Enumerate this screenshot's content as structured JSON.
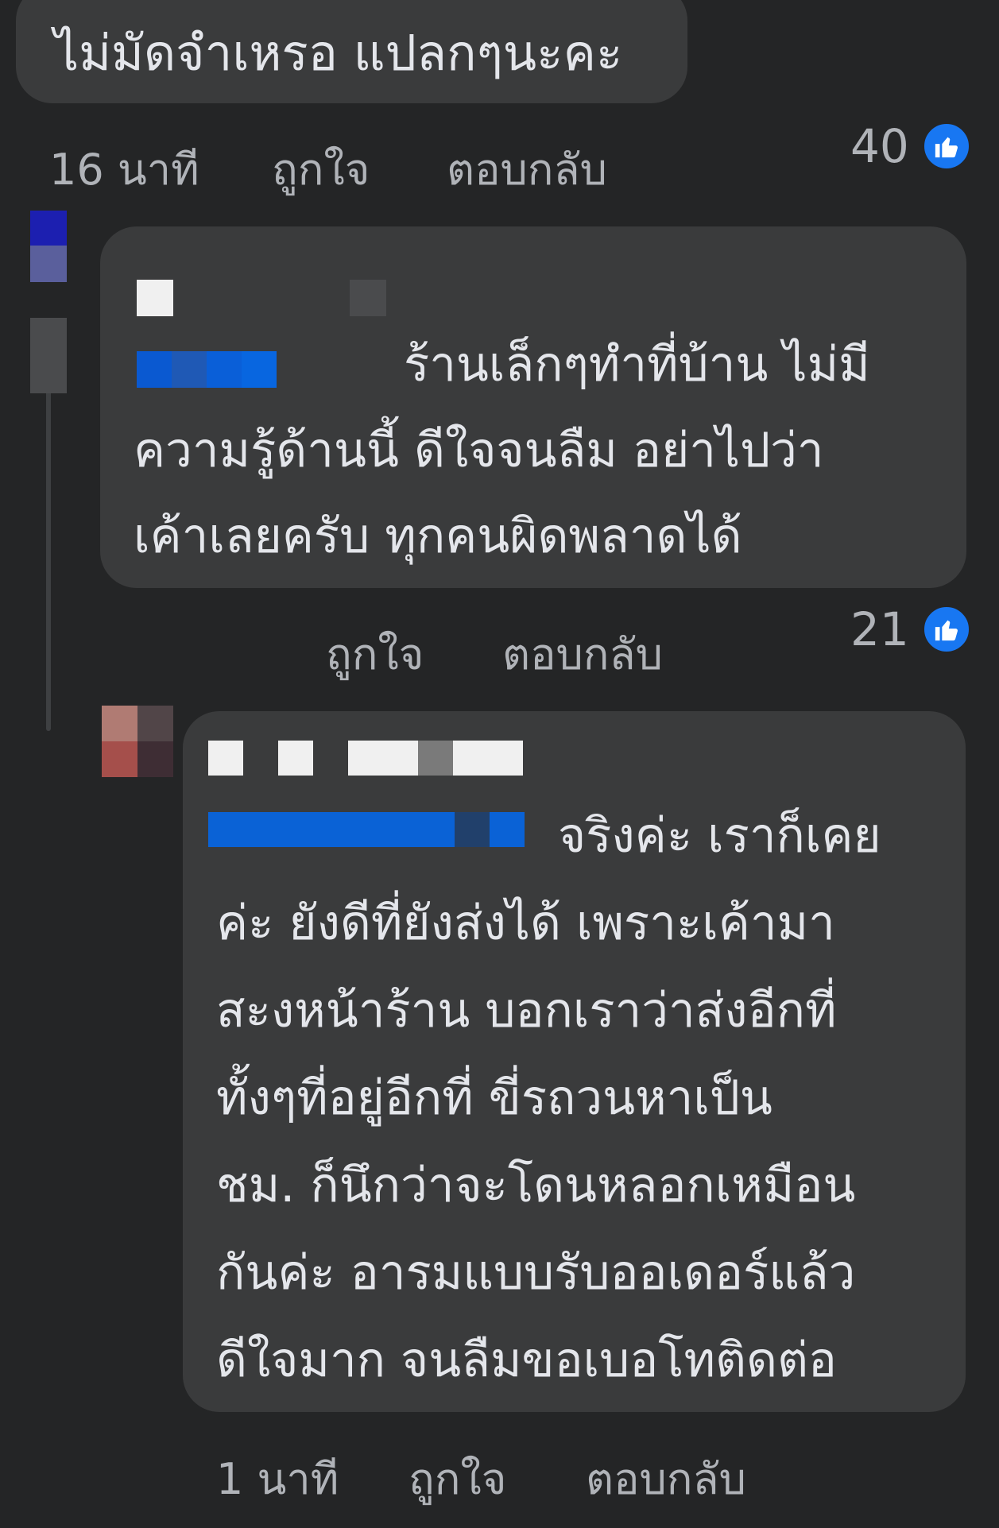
{
  "comments": [
    {
      "text": "ไม่มัดจำเหรอ แปลกๆนะคะ",
      "time": "16 นาที",
      "like_label": "ถูกใจ",
      "reply_label": "ตอบกลับ",
      "like_count": "40"
    },
    {
      "text": "ร้านเล็กๆทำที่บ้าน ไม่มี\nความรู้ด้านนี้ ดีใจจนลืม อย่าไปว่า\nเค้าเลยครับ ทุกคนผิดพลาดได้",
      "like_label": "ถูกใจ",
      "reply_label": "ตอบกลับ",
      "like_count": "21"
    },
    {
      "text": "จริงค่ะ เราก็เคย\nค่ะ ยังดีที่ยังส่งได้ เพราะเค้ามา\nสะงหน้าร้าน บอกเราว่าส่งอีกที่\nทั้งๆที่อยู่อีกที่ ขี่รถวนหาเป็น\nชม. ก็นึกว่าจะโดนหลอกเหมือน\nกันค่ะ อารมแบบรับออเดอร์แล้ว\nดีใจมาก จนลืมขอเบอโทติดต่อ",
      "time": "1 นาที",
      "like_label": "ถูกใจ",
      "reply_label": "ตอบกลับ"
    }
  ],
  "colors": {
    "background": "#242526",
    "bubble": "#3a3b3c",
    "like_blue": "#1877f2",
    "meta_text": "#b0b3b8"
  }
}
